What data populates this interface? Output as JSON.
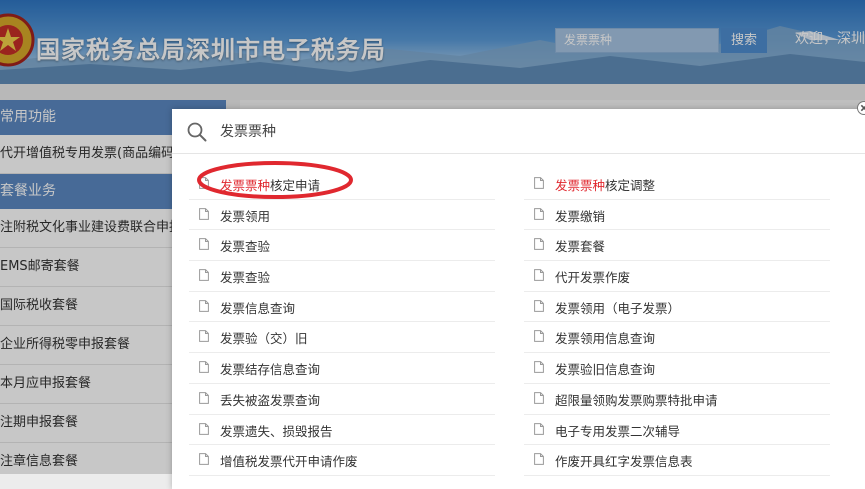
{
  "header": {
    "site_title": "国家税务总局深圳市电子税务局",
    "search_value": "发票票种",
    "search_button": "搜索",
    "welcome": "欢迎，深圳"
  },
  "sidebar": {
    "sections": [
      {
        "label": "常用功能",
        "items": [
          "代开增值税专用发票(商品编码模式)"
        ]
      },
      {
        "label": "套餐业务",
        "items": [
          "注附税文化事业建设费联合申报缴",
          "EMS邮寄套餐",
          "国际税收套餐",
          "企业所得税零申报套餐",
          "本月应申报套餐",
          "注期申报套餐",
          "注章信息套餐"
        ]
      }
    ]
  },
  "search_modal": {
    "query": "发票票种",
    "highlight_term": "发票票种",
    "highlight_color": "#e0282f",
    "annotation_color": "#e0282f",
    "results_left": [
      {
        "hl": "发票票种",
        "rest": "核定申请"
      },
      {
        "hl": "",
        "rest": "发票领用"
      },
      {
        "hl": "",
        "rest": "发票查验"
      },
      {
        "hl": "",
        "rest": "发票查验"
      },
      {
        "hl": "",
        "rest": "发票信息查询"
      },
      {
        "hl": "",
        "rest": "发票验（交）旧"
      },
      {
        "hl": "",
        "rest": "发票结存信息查询"
      },
      {
        "hl": "",
        "rest": "丢失被盗发票查询"
      },
      {
        "hl": "",
        "rest": "发票遗失、损毁报告"
      },
      {
        "hl": "",
        "rest": "增值税发票代开申请作废"
      }
    ],
    "results_right": [
      {
        "hl": "发票票种",
        "rest": "核定调整"
      },
      {
        "hl": "",
        "rest": "发票缴销"
      },
      {
        "hl": "",
        "rest": "发票套餐"
      },
      {
        "hl": "",
        "rest": "代开发票作废"
      },
      {
        "hl": "",
        "rest": "发票领用（电子发票）"
      },
      {
        "hl": "",
        "rest": "发票领用信息查询"
      },
      {
        "hl": "",
        "rest": "发票验旧信息查询"
      },
      {
        "hl": "",
        "rest": "超限量领购发票购票特批申请"
      },
      {
        "hl": "",
        "rest": "电子专用发票二次辅导"
      },
      {
        "hl": "",
        "rest": "作废开具红字发票信息表"
      }
    ]
  },
  "icons": {
    "search": "magnifier-icon",
    "result": "document-icon",
    "close": "close-icon",
    "logo": "tax-emblem-icon"
  }
}
